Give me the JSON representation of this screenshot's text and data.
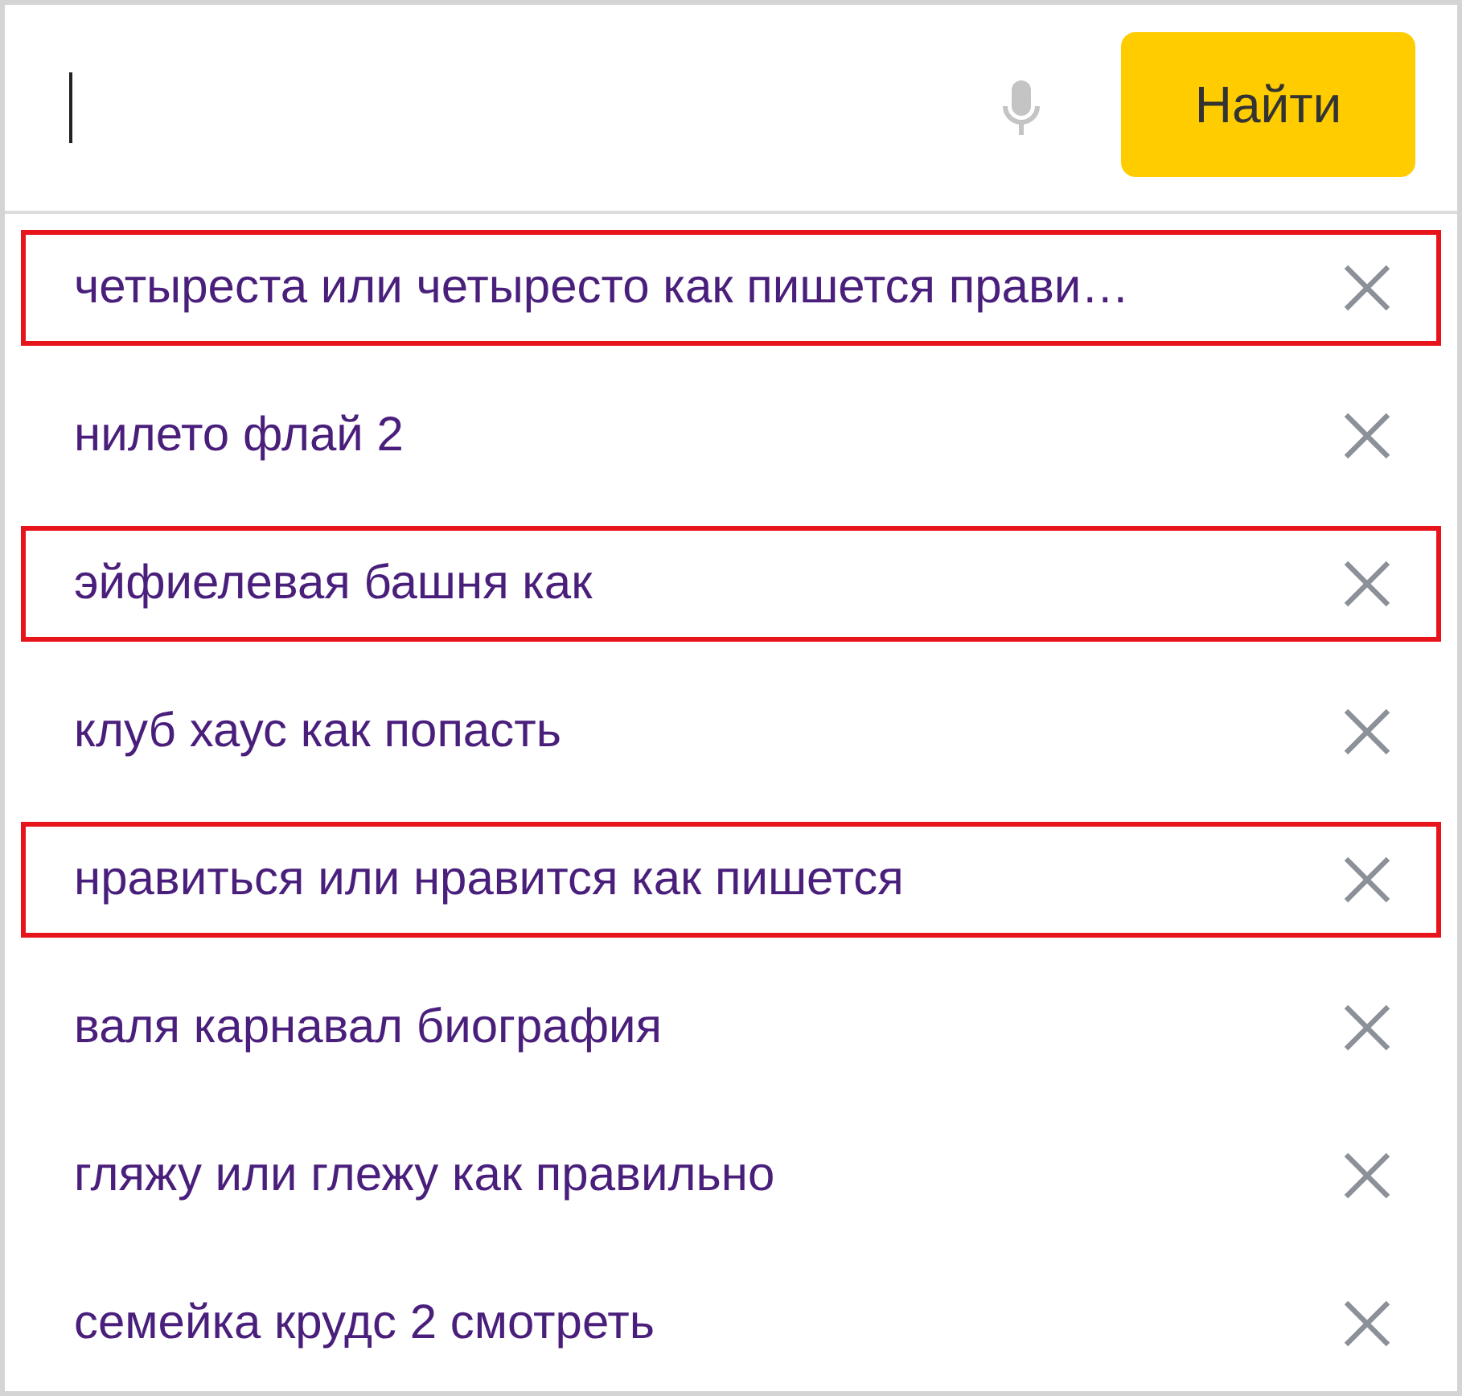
{
  "search": {
    "button": "Найти"
  },
  "suggestions": [
    {
      "text": "четыреста или четыресто как пишется прави…",
      "highlighted": true
    },
    {
      "text": "нилето флай 2",
      "highlighted": false
    },
    {
      "text": "эйфиелевая башня как",
      "highlighted": true
    },
    {
      "text": "клуб хаус как попасть",
      "highlighted": false
    },
    {
      "text": "нравиться или нравится как пишется",
      "highlighted": true
    },
    {
      "text": "валя карнавал биография",
      "highlighted": false
    },
    {
      "text": "гляжу или глежу как правильно",
      "highlighted": false
    },
    {
      "text": "семейка крудс 2 смотреть",
      "highlighted": false
    }
  ]
}
